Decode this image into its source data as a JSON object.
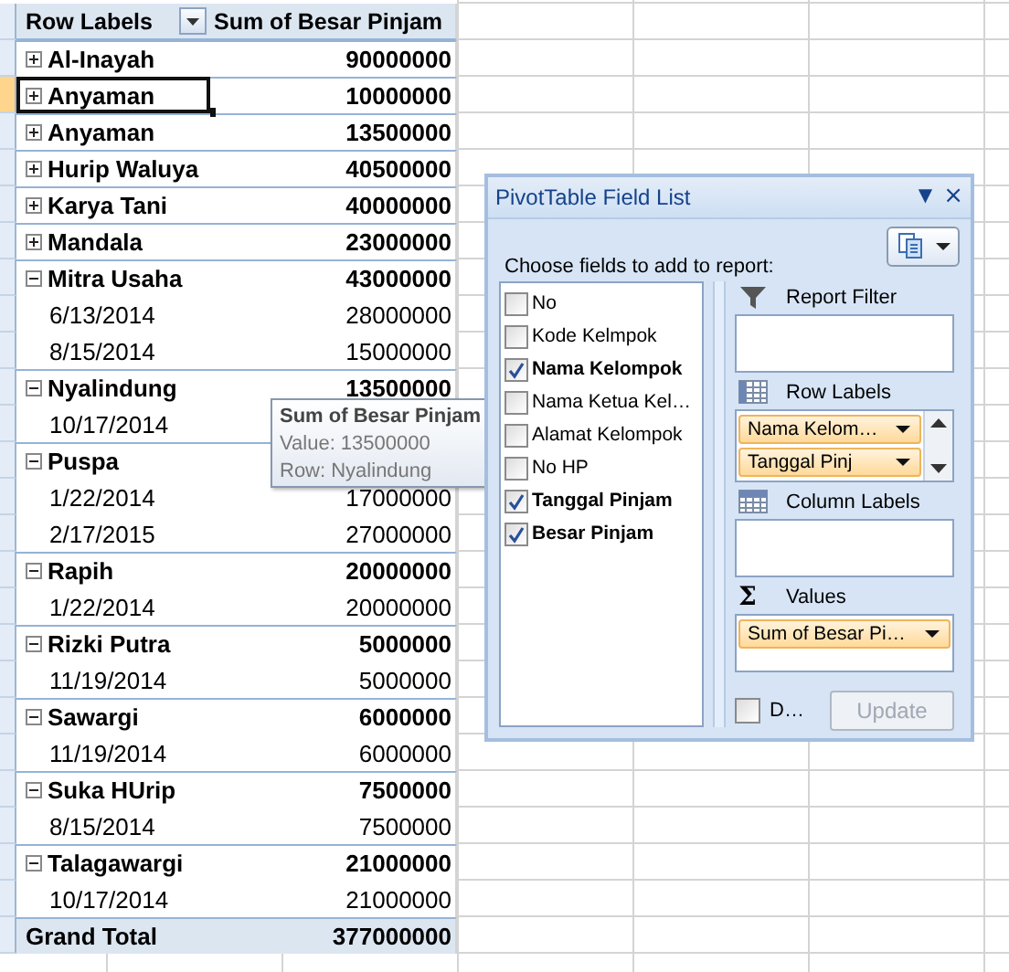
{
  "pivot": {
    "header": {
      "row_labels": "Row Labels",
      "values": "Sum of Besar Pinjam"
    },
    "groups": [
      {
        "label": "Al-Inayah",
        "value": "90000000",
        "expanded": false,
        "selected": false
      },
      {
        "label": "Anyaman",
        "value": "10000000",
        "expanded": false,
        "selected": true
      },
      {
        "label": "Anyaman",
        "value": "13500000",
        "expanded": false,
        "selected": false
      },
      {
        "label": "Hurip Waluya",
        "value": "40500000",
        "expanded": false,
        "selected": false
      },
      {
        "label": "Karya Tani",
        "value": "40000000",
        "expanded": false,
        "selected": false
      },
      {
        "label": "Mandala",
        "value": "23000000",
        "expanded": false,
        "selected": false
      },
      {
        "label": "Mitra Usaha",
        "value": "43000000",
        "expanded": true,
        "selected": false,
        "children": [
          {
            "label": "6/13/2014",
            "value": "28000000"
          },
          {
            "label": "8/15/2014",
            "value": "15000000"
          }
        ]
      },
      {
        "label": "Nyalindung",
        "value": "13500000",
        "expanded": true,
        "selected": false,
        "children": [
          {
            "label": "10/17/2014"
          }
        ]
      },
      {
        "label": "Puspa",
        "expanded": true,
        "selected": false,
        "children": [
          {
            "label": "1/22/2014",
            "value": "17000000"
          },
          {
            "label": "2/17/2015",
            "value": "27000000"
          }
        ]
      },
      {
        "label": "Rapih",
        "value": "20000000",
        "expanded": true,
        "selected": false,
        "children": [
          {
            "label": "1/22/2014",
            "value": "20000000"
          }
        ]
      },
      {
        "label": "Rizki Putra",
        "value": "5000000",
        "expanded": true,
        "selected": false,
        "children": [
          {
            "label": "11/19/2014",
            "value": "5000000"
          }
        ]
      },
      {
        "label": "Sawargi",
        "value": "6000000",
        "expanded": true,
        "selected": false,
        "children": [
          {
            "label": "11/19/2014",
            "value": "6000000"
          }
        ]
      },
      {
        "label": "Suka HUrip",
        "value": "7500000",
        "expanded": true,
        "selected": false,
        "children": [
          {
            "label": "8/15/2014",
            "value": "7500000"
          }
        ]
      },
      {
        "label": "Talagawargi",
        "value": "21000000",
        "expanded": true,
        "selected": false,
        "children": [
          {
            "label": "10/17/2014",
            "value": "21000000"
          }
        ]
      }
    ],
    "grand_total": {
      "label": "Grand Total",
      "value": "377000000"
    }
  },
  "tooltip": {
    "title": "Sum of Besar Pinjam",
    "lines": [
      "Value: 13500000",
      "Row: Nyalindung"
    ]
  },
  "field_list": {
    "title": "PivotTable Field List",
    "menu_glyph": "▼",
    "close_glyph": "×",
    "prompt": "Choose fields to add to report:",
    "fields": [
      {
        "label": "No",
        "checked": false
      },
      {
        "label": "Kode Kelmpok",
        "checked": false
      },
      {
        "label": "Nama Kelompok",
        "checked": true
      },
      {
        "label": "Nama Ketua Kel…",
        "checked": false
      },
      {
        "label": "Alamat Kelompok",
        "checked": false
      },
      {
        "label": "No HP",
        "checked": false
      },
      {
        "label": "Tanggal Pinjam",
        "checked": true
      },
      {
        "label": "Besar Pinjam",
        "checked": true
      }
    ],
    "areas": [
      {
        "kind": "filter",
        "label": "Report Filter"
      },
      {
        "kind": "rows",
        "label": "Row Labels",
        "items": [
          "Nama Kelom…",
          "Tanggal Pinj"
        ]
      },
      {
        "kind": "columns",
        "label": "Column Labels"
      },
      {
        "kind": "values",
        "label": "Values",
        "glyph": "Σ",
        "items": [
          "Sum of Besar Pi…"
        ]
      }
    ],
    "defer": {
      "label": "D…",
      "checked": false
    },
    "update": {
      "label": "Update",
      "disabled": true
    }
  }
}
